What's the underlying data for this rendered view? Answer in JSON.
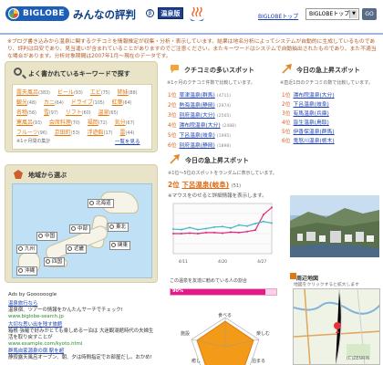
{
  "header": {
    "logo_text": "BIGLOBE",
    "site_name": "みんなの評判",
    "beta": "β",
    "section_badge": "温泉版",
    "top_link": "BIGLOBEトップ",
    "select_value": "BIGLOBEトップ",
    "go_label": "GO"
  },
  "intro": "※ブログ書き込みから温泉に関するクチコミを情報推定が収集・分析・表示しています。結果は地名分析によってシステムが自動的に生成しているものであり、評判は目安であり、見当違いが含まれていることがありますのでご注意ください。またキーワードはシステムで自動抽出されたものであり、また不適当な場合があります。分析対象期間は2007年1月〜現在のデータです。",
  "keywords": {
    "title": "よく書かれているキーワードで探す",
    "items": [
      {
        "label": "露天風呂",
        "count": "(383)"
      },
      {
        "label": "ビール",
        "count": "(93)"
      },
      {
        "label": "エビ",
        "count": "(75)"
      },
      {
        "label": "姉妹",
        "count": "(88)"
      },
      {
        "label": "観光",
        "count": "(48)"
      },
      {
        "label": "カニ",
        "count": "(64)"
      },
      {
        "label": "ドライブ",
        "count": "(105)"
      },
      {
        "label": "紅葉",
        "count": "(64)"
      },
      {
        "label": "名物",
        "count": "(56)"
      },
      {
        "label": "雪",
        "count": "(97)"
      },
      {
        "label": "リフト",
        "count": "(60)"
      },
      {
        "label": "温泉",
        "count": "(65)"
      },
      {
        "label": "寒風呂",
        "count": "(93)"
      },
      {
        "label": "会席料理",
        "count": "(70)"
      },
      {
        "label": "福岡",
        "count": "(72)"
      },
      {
        "label": "気分",
        "count": "(67)"
      },
      {
        "label": "フルーツ",
        "count": "(96)"
      },
      {
        "label": "京田町",
        "count": "(53)"
      },
      {
        "label": "浮遊館",
        "count": "(17)"
      },
      {
        "label": "雷",
        "count": "(44)"
      }
    ],
    "note": "※1ヶ月間の集計",
    "more": "一覧を見る"
  },
  "map": {
    "title": "地域から選ぶ",
    "regions": [
      "北海道",
      "東北",
      "中部",
      "関東",
      "中国",
      "近畿",
      "九州",
      "四国",
      "沖縄"
    ]
  },
  "ads": {
    "title": "Ads by Goooooogle",
    "items": [
      {
        "title": "温泉旅行なら",
        "desc": "温泉宿、ツアーの情報をかんたんサーチでチェック!",
        "url": "www.biglobe-search.jp"
      },
      {
        "title": "大切な思い出を残す旅館",
        "desc": "箱根 強羅で好みがとても楽しめる一泊は 大迷観湯館時代の夫婦生活を取り戻すことが",
        "url": "www.example.com/kyoto.html"
      },
      {
        "title": "群馬自家源泉の宿 駅を超",
        "desc": "静寂露天風呂オープン、朝、夕は時間指定でお部屋だし。おかめ!",
        "url": ""
      }
    ]
  },
  "kuchikomi": {
    "title": "クチコミの多いスポット",
    "subtitle": "※1ヶ月のクチコミ件数で比較しています。",
    "items": [
      {
        "rank": "1位",
        "name": "草津温泉(群馬)",
        "count": "(4711)"
      },
      {
        "rank": "2位",
        "name": "熱海温泉(静岡)",
        "count": "(2974)"
      },
      {
        "rank": "3位",
        "name": "別府温泉(大分)",
        "count": "(2565)"
      },
      {
        "rank": "4位",
        "name": "湯布院温泉(大分)",
        "count": "(2488)"
      },
      {
        "rank": "5位",
        "name": "下呂温泉(岐阜)",
        "count": "(1995)"
      },
      {
        "rank": "6位",
        "name": "別府温泉(静岡)",
        "count": "(1898)"
      }
    ]
  },
  "today_rise": {
    "title": "今日の急上昇スポット",
    "subtitle": "※直近1日のクチコミの数で比較しています。",
    "items": [
      {
        "rank": "1位",
        "name": "湯布院温泉(大分)"
      },
      {
        "rank": "2位",
        "name": "下呂温泉(岐阜)"
      },
      {
        "rank": "3位",
        "name": "有馬温泉(兵庫)"
      },
      {
        "rank": "4位",
        "name": "皆生温泉(鳥取)"
      },
      {
        "rank": "5位",
        "name": "伊香保温泉(群馬)"
      },
      {
        "rank": "6位",
        "name": "鬼怒川温泉(栃木)"
      }
    ]
  },
  "featured": {
    "section_title": "今日の急上昇スポット",
    "section_subtitle": "※1位〜5位のスポットをランダムに表示しています。",
    "rank": "2位",
    "name": "下呂温泉(岐阜)",
    "count": "(51)",
    "hint": "※マウスをのせると詳細情報を表示します。",
    "rating_label": "この温泉を友達に勧めている人の割合",
    "rating_percent": "90%",
    "rating_value": 0.9
  },
  "chart_data": {
    "type": "line",
    "categories": [
      "4/11",
      "4/20",
      "4/27"
    ],
    "series": [
      {
        "name": "",
        "color": "#e0287d",
        "values": [
          40,
          40,
          41,
          40,
          42,
          42,
          41,
          43,
          42,
          44,
          47,
          78,
          92
        ]
      },
      {
        "name": "",
        "color": "#4ab5c8",
        "values": [
          49,
          48,
          52,
          48,
          50,
          53,
          54,
          51,
          57,
          55,
          60,
          64,
          61
        ]
      }
    ],
    "ylim": [
      0,
      100
    ],
    "grid": true
  },
  "radar": {
    "labels": [
      "食べる",
      "楽しむ",
      "泊まる",
      "癒し",
      "施設"
    ]
  },
  "nearby": {
    "title": "周辺地図",
    "subtitle": "地図をクリックすると拡大します",
    "copyright": "(C)ZENRIN"
  }
}
